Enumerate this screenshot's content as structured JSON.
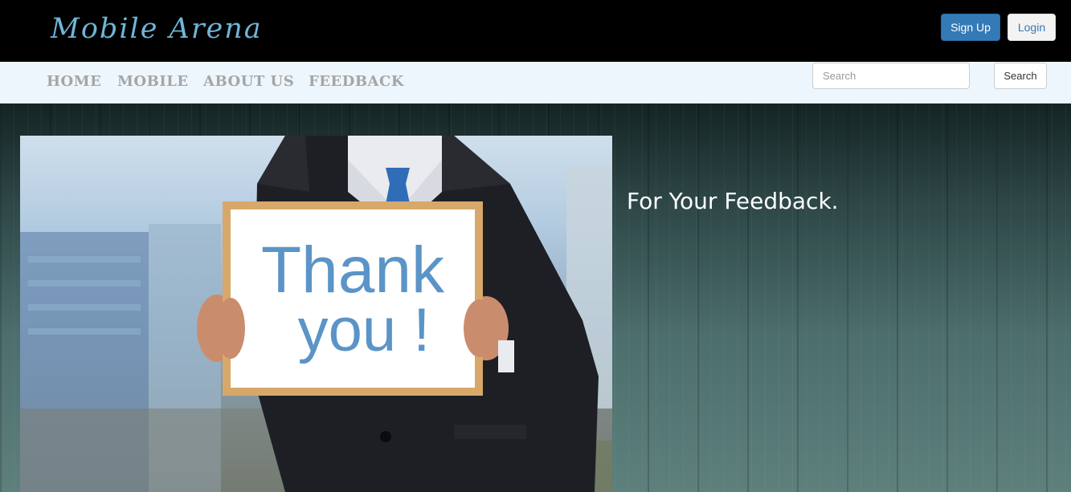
{
  "header": {
    "brand": "Mobile Arena",
    "signup_label": "Sign Up",
    "login_label": "Login"
  },
  "nav": {
    "items": [
      {
        "label": "HOME"
      },
      {
        "label": "MOBILE"
      },
      {
        "label": "ABOUT US"
      },
      {
        "label": "FEEDBACK"
      }
    ],
    "search": {
      "placeholder": "Search",
      "button_label": "Search"
    }
  },
  "hero": {
    "sign_line1": "Thank",
    "sign_line2": "you !",
    "caption": "For Your Feedback."
  },
  "colors": {
    "brand": "#6fb6d8",
    "primary_button": "#337ab7",
    "header_bg": "#000000",
    "nav_bg": "#eef6fd"
  }
}
